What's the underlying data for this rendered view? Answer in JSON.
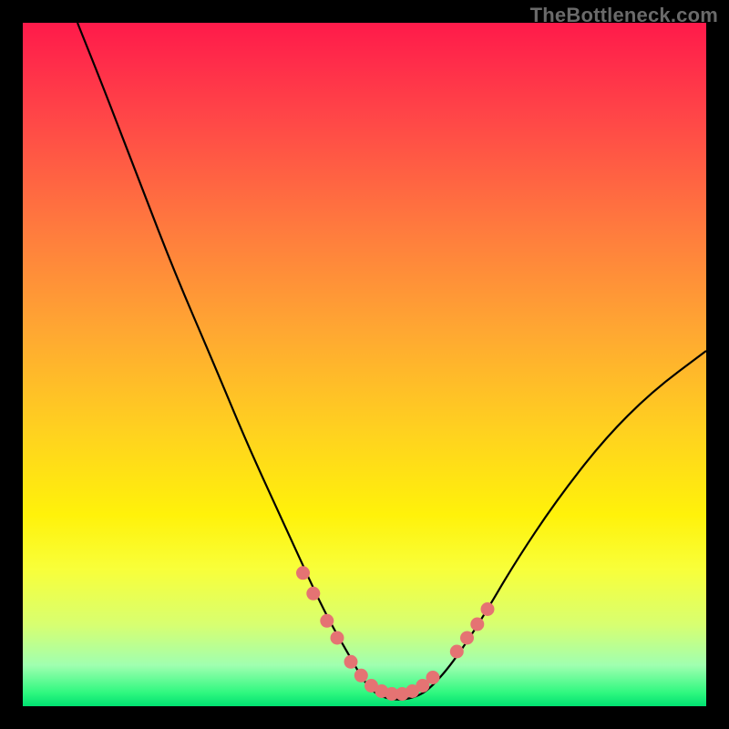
{
  "watermark": "TheBottleneck.com",
  "chart_data": {
    "type": "line",
    "title": "",
    "xlabel": "",
    "ylabel": "",
    "xlim": [
      0,
      100
    ],
    "ylim": [
      0,
      100
    ],
    "curve": {
      "description": "V-shaped bottleneck curve descending steeply from upper-left to a minimum near x≈55 then rising toward the right edge",
      "points_xy": [
        [
          8.0,
          100.0
        ],
        [
          12.0,
          90.0
        ],
        [
          17.0,
          77.0
        ],
        [
          22.0,
          64.0
        ],
        [
          28.0,
          50.0
        ],
        [
          33.0,
          38.0
        ],
        [
          39.0,
          25.0
        ],
        [
          44.0,
          14.0
        ],
        [
          48.0,
          7.0
        ],
        [
          50.0,
          3.5
        ],
        [
          52.0,
          1.5
        ],
        [
          55.0,
          0.8
        ],
        [
          58.0,
          1.5
        ],
        [
          60.0,
          3.0
        ],
        [
          63.0,
          6.5
        ],
        [
          67.0,
          12.5
        ],
        [
          72.0,
          21.0
        ],
        [
          78.0,
          30.0
        ],
        [
          85.0,
          39.0
        ],
        [
          92.0,
          46.0
        ],
        [
          100.0,
          52.0
        ]
      ]
    },
    "dots_xy": [
      [
        41.0,
        19.5
      ],
      [
        42.5,
        16.5
      ],
      [
        44.5,
        12.5
      ],
      [
        46.0,
        10.0
      ],
      [
        48.0,
        6.5
      ],
      [
        49.5,
        4.5
      ],
      [
        51.0,
        3.0
      ],
      [
        52.5,
        2.2
      ],
      [
        54.0,
        1.8
      ],
      [
        55.5,
        1.8
      ],
      [
        57.0,
        2.2
      ],
      [
        58.5,
        3.0
      ],
      [
        60.0,
        4.2
      ],
      [
        63.5,
        8.0
      ],
      [
        65.0,
        10.0
      ],
      [
        66.5,
        12.0
      ],
      [
        68.0,
        14.2
      ]
    ],
    "colors": {
      "background_gradient_top": "#ff1a4a",
      "background_gradient_bottom": "#00e070",
      "curve": "#000000",
      "dots": "#e57373",
      "frame": "#000000"
    }
  }
}
